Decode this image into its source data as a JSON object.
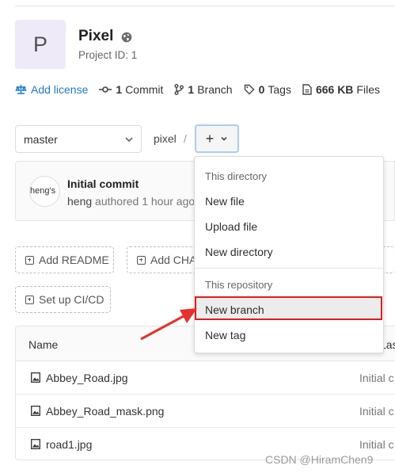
{
  "project": {
    "avatar_letter": "P",
    "name": "Pixel",
    "id_text": "Project ID: 1",
    "visibility_icon": "globe-icon"
  },
  "stats": {
    "license": "Add license",
    "commits_count": "1",
    "commits_label": "Commit",
    "branches_count": "1",
    "branches_label": "Branch",
    "tags_count": "0",
    "tags_label": "Tags",
    "files_size": "666 KB",
    "files_label": "Files"
  },
  "toolbar": {
    "branch": "master",
    "repo_crumb": "pixel",
    "separator": "/",
    "add_button": "+"
  },
  "last_commit": {
    "avatar_alt": "heng's",
    "title": "Initial commit",
    "author": "heng",
    "action": "authored",
    "time": "1 hour ago"
  },
  "quick_actions": {
    "add_readme": "Add README",
    "add_changelog": "Add CHA",
    "setup_ci": "Set up CI/CD"
  },
  "table": {
    "col_name": "Name",
    "col_commit": "Last co",
    "rows": [
      {
        "name": "Abbey_Road.jpg",
        "commit": "Initial c"
      },
      {
        "name": "Abbey_Road_mask.png",
        "commit": "Initial c"
      },
      {
        "name": "road1.jpg",
        "commit": "Initial c"
      }
    ]
  },
  "dropdown": {
    "header_directory": "This directory",
    "new_file": "New file",
    "upload_file": "Upload file",
    "new_directory": "New directory",
    "header_repository": "This repository",
    "new_branch": "New branch",
    "new_tag": "New tag",
    "highlight_color": "#e21d1d"
  },
  "watermark": "CSDN @HiramChen9"
}
